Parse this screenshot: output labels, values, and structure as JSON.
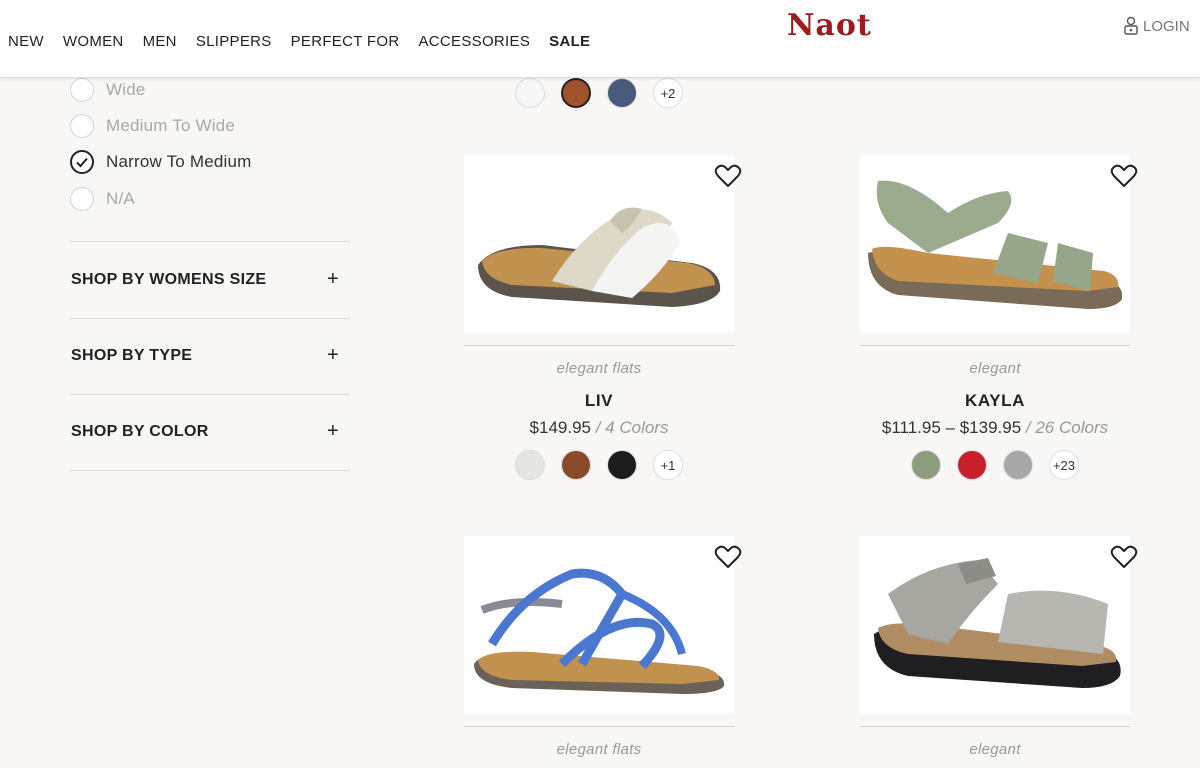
{
  "header": {
    "nav": [
      "NEW",
      "WOMEN",
      "MEN",
      "SLIPPERS",
      "PERFECT FOR",
      "ACCESSORIES",
      "SALE"
    ],
    "logo": "Naot",
    "login": "LOGIN"
  },
  "filters": {
    "width_options": [
      {
        "label": "Wide",
        "checked": false
      },
      {
        "label": "Medium To Wide",
        "checked": false
      },
      {
        "label": "Narrow To Medium",
        "checked": true
      },
      {
        "label": "N/A",
        "checked": false
      }
    ],
    "sections": [
      "SHOP BY WOMENS SIZE",
      "SHOP BY TYPE",
      "SHOP BY COLOR"
    ]
  },
  "top_swatches": {
    "colors": [
      "#f4f6f8",
      "#a0522d",
      "#4a5a7a"
    ],
    "more": "+2"
  },
  "products": [
    {
      "category": "elegant flats",
      "name": "LIV",
      "price": "$149.95",
      "colors_text": "/ 4 Colors",
      "swatches": [
        "#e4e6e3",
        "#8a4a2a",
        "#1c1c1c"
      ],
      "more": "+1"
    },
    {
      "category": "elegant",
      "name": "KAYLA",
      "price": "$111.95 – $139.95",
      "colors_text": "/ 26 Colors",
      "swatches": [
        "#8c9c7c",
        "#c8202a",
        "#a8a8a8"
      ],
      "more": "+23"
    },
    {
      "category": "elegant flats",
      "name": "",
      "price": "",
      "colors_text": ""
    },
    {
      "category": "elegant",
      "name": "",
      "price": "",
      "colors_text": ""
    }
  ]
}
